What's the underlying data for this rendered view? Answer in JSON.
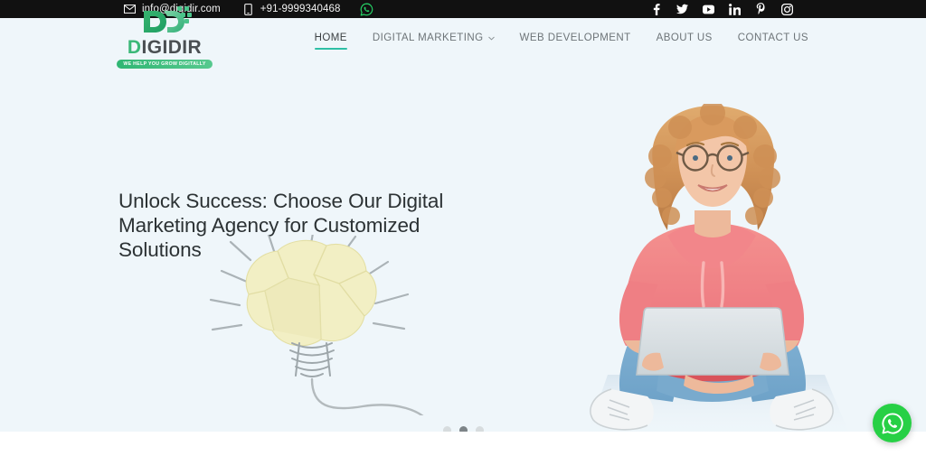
{
  "topbar": {
    "email": "info@digidir.com",
    "phone": "+91-9999340468",
    "email_icon": "envelope-icon",
    "phone_icon": "mobile-phone-icon",
    "whatsapp_icon": "whatsapp-icon",
    "socials": [
      {
        "name": "facebook-icon",
        "label": "Facebook"
      },
      {
        "name": "twitter-icon",
        "label": "Twitter"
      },
      {
        "name": "youtube-icon",
        "label": "YouTube"
      },
      {
        "name": "linkedin-icon",
        "label": "LinkedIn"
      },
      {
        "name": "pinterest-icon",
        "label": "Pinterest"
      },
      {
        "name": "instagram-icon",
        "label": "Instagram"
      }
    ],
    "background": "#111111"
  },
  "logo": {
    "mark_letters": "DD",
    "wordmark_prefix": "D",
    "wordmark_rest": "IGIDIR",
    "wordmark_full": "DIGIDIR",
    "tagline": "WE HELP YOU GROW DIGITALLY",
    "green": "#3bb878",
    "tagline_bg": "#2fb673"
  },
  "nav": {
    "items": [
      {
        "label": "HOME",
        "active": true,
        "has_dropdown": false
      },
      {
        "label": "DIGITAL MARKETING",
        "active": false,
        "has_dropdown": true
      },
      {
        "label": "WEB DEVELOPMENT",
        "active": false,
        "has_dropdown": false
      },
      {
        "label": "ABOUT US",
        "active": false,
        "has_dropdown": false
      },
      {
        "label": "CONTACT US",
        "active": false,
        "has_dropdown": false
      }
    ],
    "active_underline_color": "#2ebfa5",
    "dropdown_icon": "chevron-down-icon"
  },
  "hero": {
    "title_line1": "Unlock Success: Choose Our Digital",
    "title_line2": "Marketing Agency for Customized Solutions",
    "background": "#eff6fa",
    "illustration_lightbulb": "crumpled-paper-lightbulb",
    "illustration_person": "woman-with-laptop-photo"
  },
  "carousel": {
    "slides": 3,
    "active_index": 1,
    "dot_color": "#d7dcde",
    "active_dot_color": "#7d8488"
  },
  "fab": {
    "icon": "whatsapp-icon",
    "color": "#27d045"
  }
}
